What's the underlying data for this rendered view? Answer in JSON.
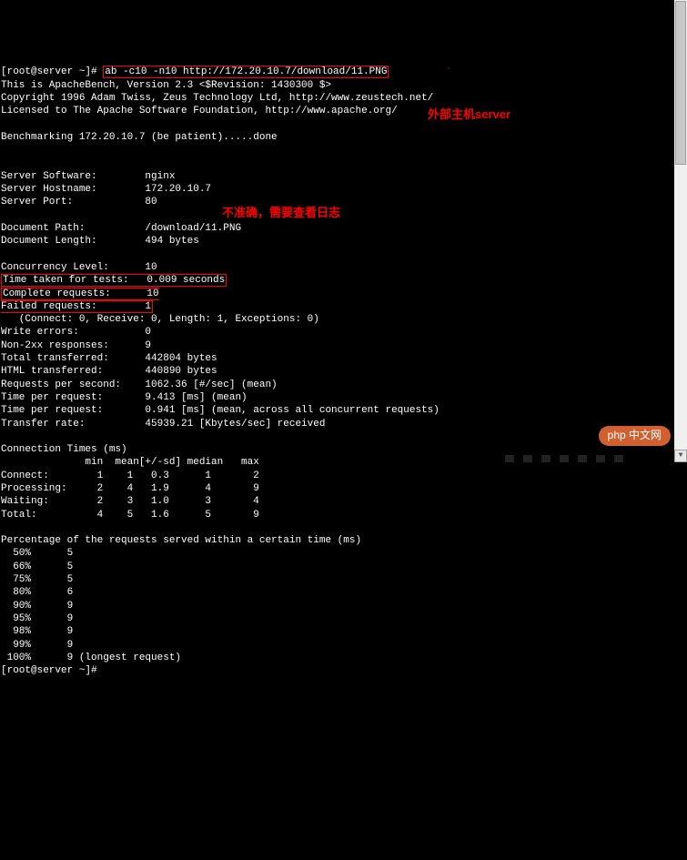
{
  "prompt_line": {
    "prefix": "[root@server ~]# ",
    "command": "ab -c10 -n10 http://172.20.10.7/download/11.PNG"
  },
  "header_lines": [
    "This is ApacheBench, Version 2.3 <$Revision: 1430300 $>",
    "Copyright 1996 Adam Twiss, Zeus Technology Ltd, http://www.zeustech.net/",
    "Licensed to The Apache Software Foundation, http://www.apache.org/"
  ],
  "benchmark_line": "Benchmarking 172.20.10.7 (be patient).....done",
  "server_info": [
    "Server Software:        nginx",
    "Server Hostname:        172.20.10.7",
    "Server Port:            80"
  ],
  "document_info": [
    "Document Path:          /download/11.PNG",
    "Document Length:        494 bytes"
  ],
  "results_block1": [
    "Concurrency Level:      10"
  ],
  "time_taken": "Time taken for tests:   0.009 seconds",
  "complete_requests": "Complete requests:      10",
  "failed_requests": "Failed requests:        1",
  "results_block2": [
    "   (Connect: 0, Receive: 0, Length: 1, Exceptions: 0)",
    "Write errors:           0",
    "Non-2xx responses:      9",
    "Total transferred:      442804 bytes",
    "HTML transferred:       440890 bytes",
    "Requests per second:    1062.36 [#/sec] (mean)",
    "Time per request:       9.413 [ms] (mean)",
    "Time per request:       0.941 [ms] (mean, across all concurrent requests)",
    "Transfer rate:          45939.21 [Kbytes/sec] received"
  ],
  "conn_header": "Connection Times (ms)",
  "conn_cols": "              min  mean[+/-sd] median   max",
  "conn_rows": [
    "Connect:        1    1   0.3      1       2",
    "Processing:     2    4   1.9      4       9",
    "Waiting:        2    3   1.0      3       4",
    "Total:          4    5   1.6      5       9"
  ],
  "pct_header": "Percentage of the requests served within a certain time (ms)",
  "pct_rows": [
    "  50%      5",
    "  66%      5",
    "  75%      5",
    "  80%      6",
    "  90%      9",
    "  95%      9",
    "  98%      9",
    "  99%      9",
    " 100%      9 (longest request)"
  ],
  "final_prompt": "[root@server ~]# ",
  "annotations": {
    "server_label": "外部主机server",
    "log_label": "不准确，需要查看日志"
  },
  "badge": "php 中文网",
  "scrollbar_down": "▼"
}
